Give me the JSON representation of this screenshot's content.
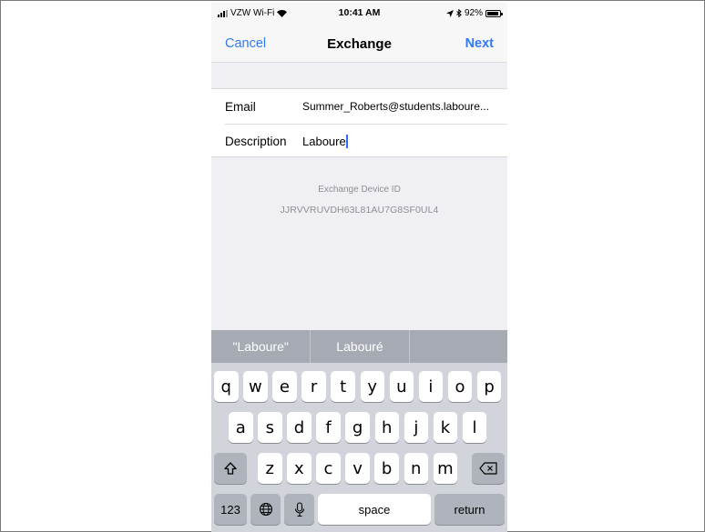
{
  "status_bar": {
    "carrier": "VZW Wi-Fi",
    "time": "10:41 AM",
    "battery": "92%",
    "battery_level": 0.92
  },
  "nav": {
    "cancel_label": "Cancel",
    "title": "Exchange",
    "next_label": "Next"
  },
  "form": {
    "email_label": "Email",
    "email_value": "Summer_Roberts@students.laboure...",
    "description_label": "Description",
    "description_value": "Laboure"
  },
  "device": {
    "label": "Exchange Device ID",
    "id": "JJRVVRUVDH63L81AU7G8SF0UL4"
  },
  "keyboard": {
    "suggestions": [
      "\"Laboure\"",
      "Labouré",
      ""
    ],
    "row1": [
      "q",
      "w",
      "e",
      "r",
      "t",
      "y",
      "u",
      "i",
      "o",
      "p"
    ],
    "row2": [
      "a",
      "s",
      "d",
      "f",
      "g",
      "h",
      "j",
      "k",
      "l"
    ],
    "row3": [
      "z",
      "x",
      "c",
      "v",
      "b",
      "n",
      "m"
    ],
    "numbers_label": "123",
    "space_label": "space",
    "return_label": "return"
  },
  "icons": {
    "shift": "shift-icon",
    "backspace": "backspace-icon",
    "globe": "globe-icon",
    "mic": "microphone-icon"
  }
}
